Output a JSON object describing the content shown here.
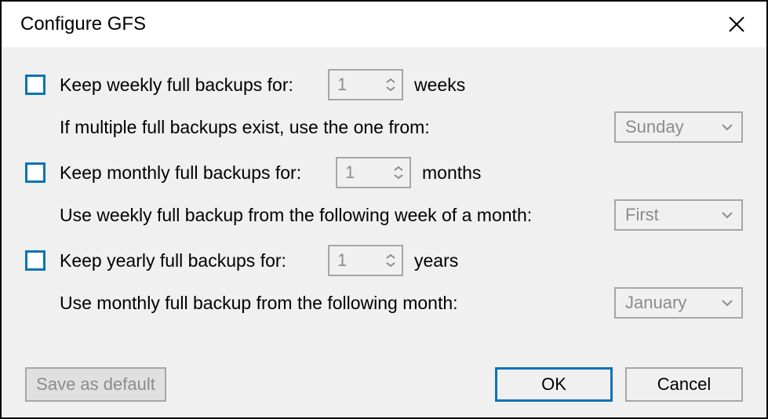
{
  "window": {
    "title": "Configure GFS"
  },
  "weekly": {
    "checkbox_label": "Keep weekly full backups for:",
    "value": "1",
    "unit": "weeks",
    "sub_label": "If multiple full backups exist, use the one from:",
    "dropdown_selected": "Sunday"
  },
  "monthly": {
    "checkbox_label": "Keep monthly full backups for:",
    "value": "1",
    "unit": "months",
    "sub_label": "Use weekly full backup from the following week of a month:",
    "dropdown_selected": "First"
  },
  "yearly": {
    "checkbox_label": "Keep yearly full backups for:",
    "value": "1",
    "unit": "years",
    "sub_label": "Use monthly full backup from the following month:",
    "dropdown_selected": "January"
  },
  "buttons": {
    "save_default": "Save as default",
    "ok": "OK",
    "cancel": "Cancel"
  }
}
